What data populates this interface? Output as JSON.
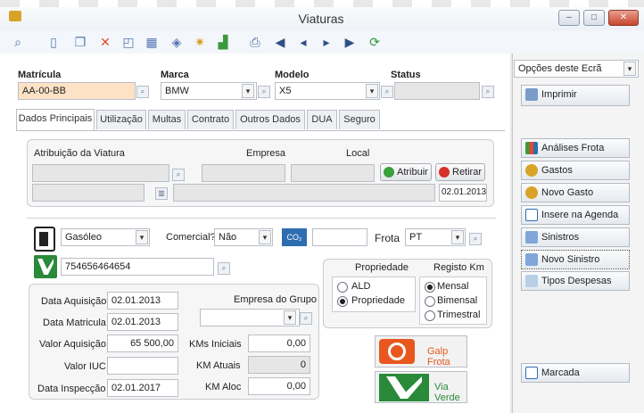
{
  "window": {
    "title": "Viaturas",
    "min": "–",
    "max": "□",
    "close": "✕"
  },
  "colors": {
    "accent": "#2e7d32",
    "orange": "#e8581e",
    "pink_field": "#fde2c6"
  },
  "header": {
    "matricula_label": "Matrícula",
    "matricula_value": "AA-00-BB",
    "marca_label": "Marca",
    "marca_value": "BMW",
    "modelo_label": "Modelo",
    "modelo_value": "X5",
    "status_label": "Status",
    "status_value": ""
  },
  "tabs": [
    "Dados Principais",
    "Utilização",
    "Multas",
    "Contrato",
    "Outros Dados",
    "DUA",
    "Seguro"
  ],
  "atribuicao": {
    "label": "Atribuição da Viatura",
    "empresa_label": "Empresa",
    "local_label": "Local",
    "atribuir": "Atribuir",
    "retirar": "Retirar",
    "date": "02.01.2013"
  },
  "combustivel": {
    "value": "Gasóleo",
    "comercial_label": "Comercial?",
    "comercial_value": "Não",
    "co2_label": "CO₂",
    "frota_label": "Frota",
    "frota_value": "PT"
  },
  "via_verde_number": "754656464654",
  "dates": {
    "aquisicao_label": "Data Aquisição",
    "aquisicao": "02.01.2013",
    "matricula_label": "Data Matricula",
    "matricula": "02.01.2013",
    "valor_aq_label": "Valor Aquisição",
    "valor_aq": "65 500,00",
    "iuc_label": "Valor IUC",
    "iuc": "",
    "inspeccao_label": "Data Inspecção",
    "inspeccao": "02.01.2017",
    "empresa_grupo_label": "Empresa do Grupo",
    "km_iniciais_label": "KMs Iniciais",
    "km_iniciais": "0,00",
    "km_atuais_label": "KM Atuais",
    "km_atuais": "0",
    "km_aloc_label": "KM Aloc",
    "km_aloc": "0,00"
  },
  "propriedade": {
    "label": "Propriedade",
    "opt1": "ALD",
    "opt2": "Propriedade"
  },
  "registo": {
    "label": "Registo Km",
    "opt1": "Mensal",
    "opt2": "Bimensal",
    "opt3": "Trimestral"
  },
  "logos": {
    "galp": "Galp Frota",
    "via": "Via Verde"
  },
  "side": {
    "options_label": "Opções deste Ecrã",
    "imprimir": "Imprimir",
    "items": [
      "Análises Frota",
      "Gastos",
      "Novo Gasto",
      "Insere na Agenda",
      "Sinistros",
      "Novo Sinistro",
      "Tipos Despesas"
    ],
    "marcada": "Marcada"
  }
}
